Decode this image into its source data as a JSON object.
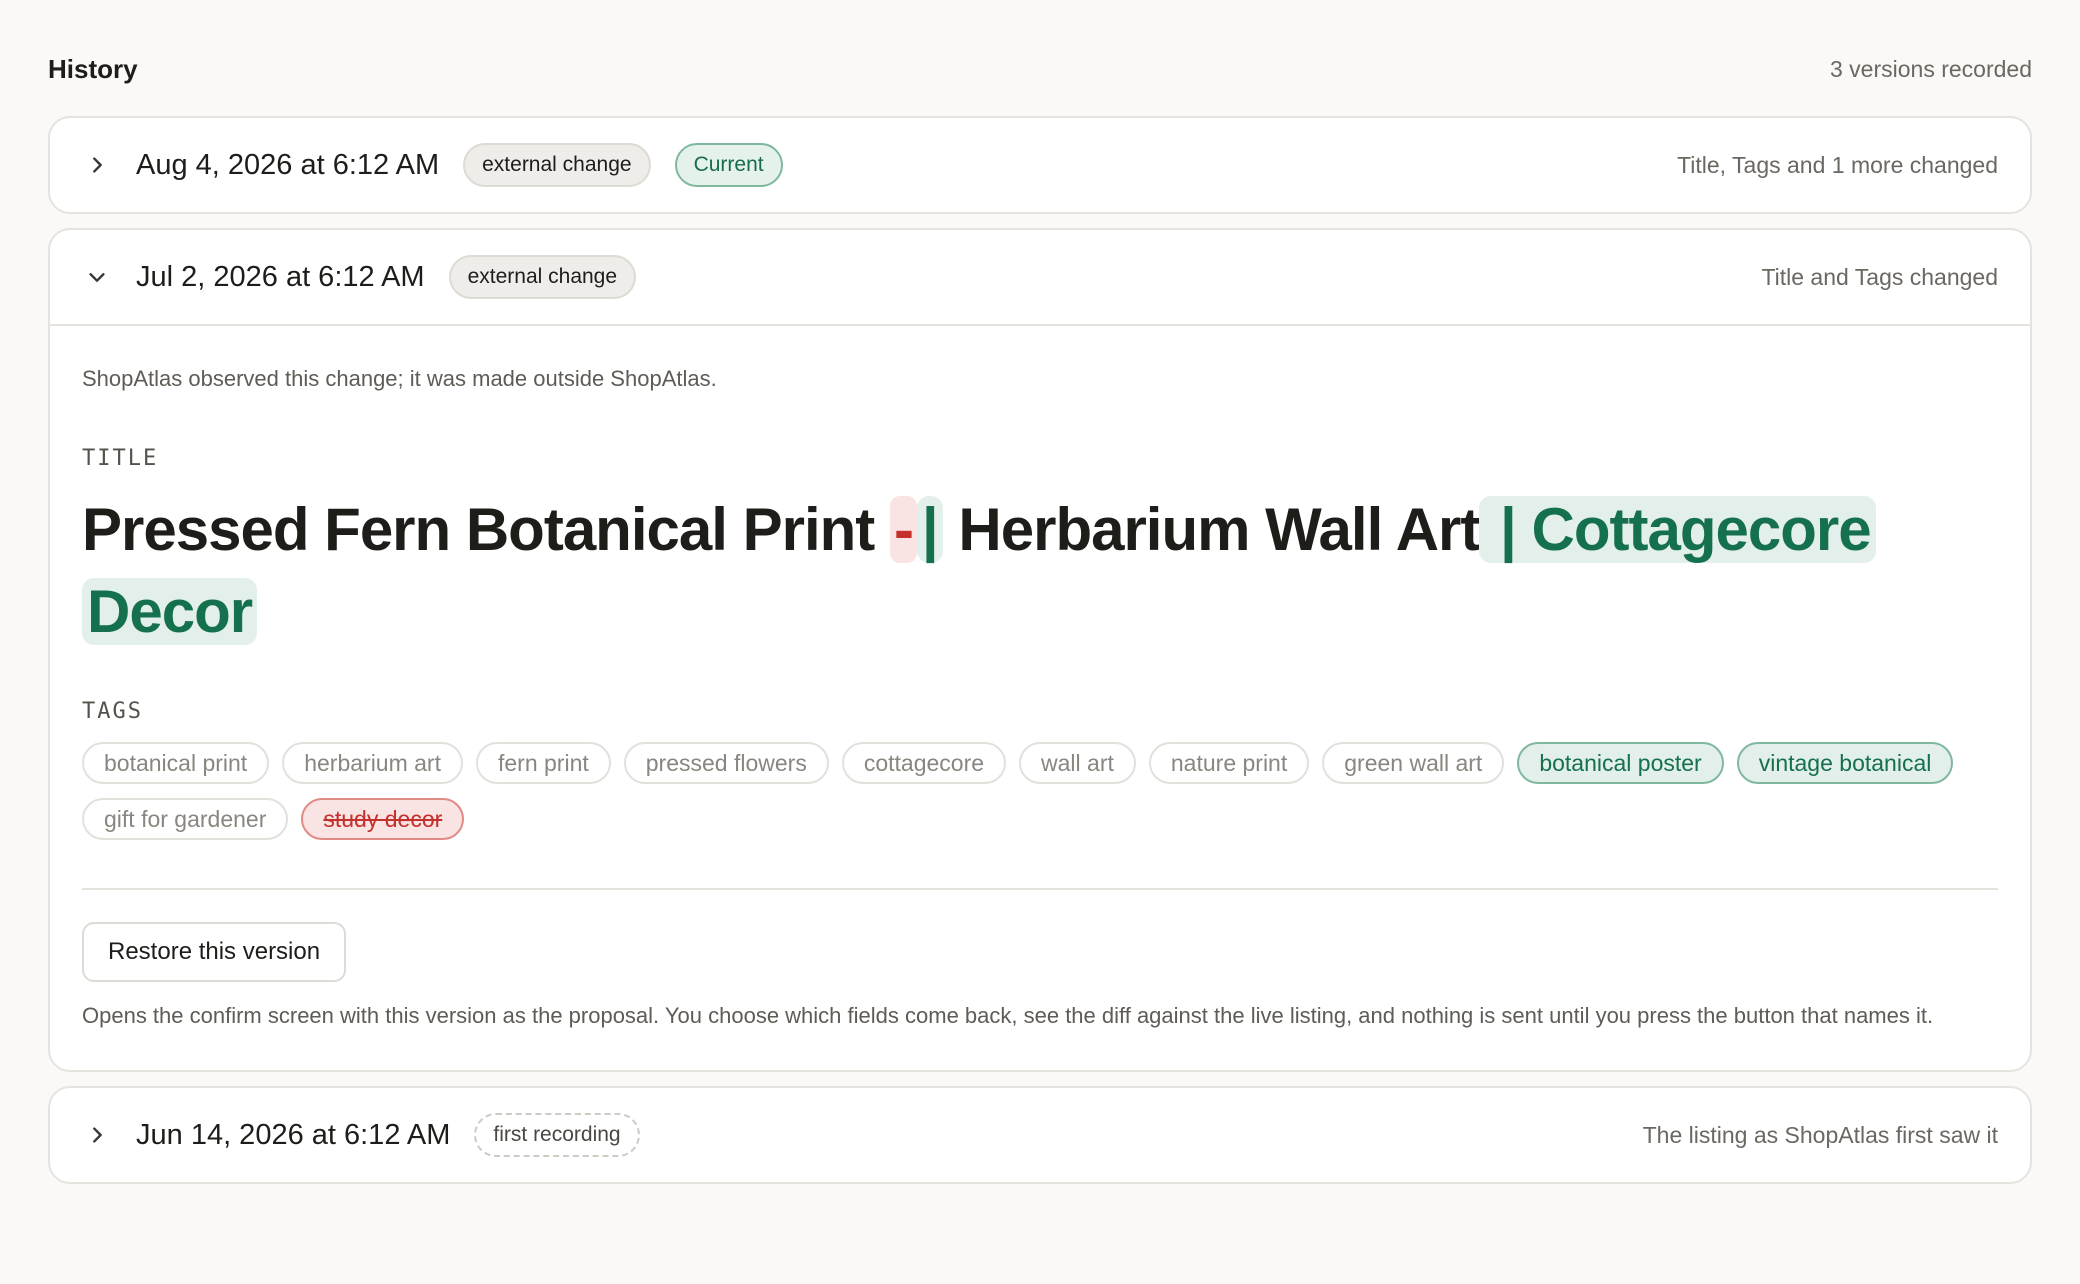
{
  "history": {
    "title": "History",
    "count_label": "3 versions recorded"
  },
  "versions": [
    {
      "date": "Aug 4, 2026 at 6:12 AM",
      "badges": [
        "external change",
        "Current"
      ],
      "summary": "Title, Tags and 1 more changed",
      "expanded": false
    },
    {
      "date": "Jul 2, 2026 at 6:12 AM",
      "badges": [
        "external change"
      ],
      "summary": "Title and Tags changed",
      "expanded": true,
      "observed_note": "ShopAtlas observed this change; it was made outside ShopAtlas.",
      "title_label": "TITLE",
      "title_diff": {
        "part1": "Pressed Fern Botanical Print ",
        "removed": "-",
        "added_1": "|",
        "part2": " Herbarium Wall Art",
        "added_2": " | Cottagecore",
        "added_3": "Decor"
      },
      "tags_label": "TAGS",
      "tags": [
        {
          "text": "botanical print",
          "state": "unchanged"
        },
        {
          "text": "herbarium art",
          "state": "unchanged"
        },
        {
          "text": "fern print",
          "state": "unchanged"
        },
        {
          "text": "pressed flowers",
          "state": "unchanged"
        },
        {
          "text": "cottagecore",
          "state": "unchanged"
        },
        {
          "text": "wall art",
          "state": "unchanged"
        },
        {
          "text": "nature print",
          "state": "unchanged"
        },
        {
          "text": "green wall art",
          "state": "unchanged"
        },
        {
          "text": "botanical poster",
          "state": "added"
        },
        {
          "text": "vintage botanical",
          "state": "added"
        },
        {
          "text": "gift for gardener",
          "state": "unchanged"
        },
        {
          "text": "study decor",
          "state": "removed"
        }
      ],
      "restore_label": "Restore this version",
      "restore_note": "Opens the confirm screen with this version as the proposal. You choose which fields come back, see the diff against the live listing, and nothing is sent until you press the button that names it."
    },
    {
      "date": "Jun 14, 2026 at 6:12 AM",
      "badges": [
        "first recording"
      ],
      "summary": "The listing as ShopAtlas first saw it",
      "expanded": false
    }
  ],
  "icons": {
    "collapsed": "chevron-right-icon",
    "expanded": "chevron-down-icon"
  },
  "colors": {
    "added_text": "#15704d",
    "added_bg": "#e3efea",
    "removed_text": "#c4302b",
    "removed_bg": "#f9e3e3"
  }
}
